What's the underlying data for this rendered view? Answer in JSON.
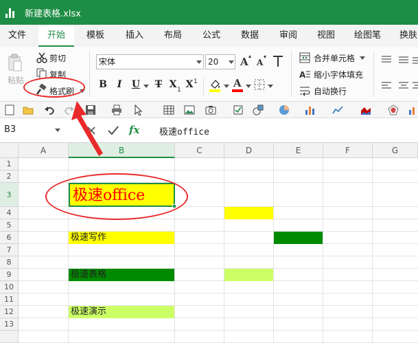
{
  "window": {
    "title": "新建表格.xlsx"
  },
  "menu": {
    "tabs": [
      {
        "label": "文件",
        "active": false
      },
      {
        "label": "开始",
        "active": true
      },
      {
        "label": "模板",
        "active": false
      },
      {
        "label": "插入",
        "active": false
      },
      {
        "label": "布局",
        "active": false
      },
      {
        "label": "公式",
        "active": false
      },
      {
        "label": "数据",
        "active": false
      },
      {
        "label": "审阅",
        "active": false
      },
      {
        "label": "视图",
        "active": false
      },
      {
        "label": "绘图笔",
        "active": false
      },
      {
        "label": "换肤",
        "active": false
      }
    ]
  },
  "ribbon": {
    "paste_label": "粘贴",
    "cut_label": "剪切",
    "copy_label": "复制",
    "format_painter_label": "格式刷",
    "font_name": "宋体",
    "font_size": "20",
    "bold": "B",
    "italic": "I",
    "underline": "U",
    "strikethrough": "T",
    "subscript": "X",
    "subscript_mark": "1",
    "superscript": "X",
    "superscript_mark": "1",
    "font_color_glyph": "A",
    "merge_label": "合并单元格",
    "shrink_label": "缩小字体填充",
    "wrap_label": "自动换行",
    "colors": {
      "highlight": "#ffff00",
      "font_color": "#ff0000"
    }
  },
  "formula_bar": {
    "cell_ref": "B3",
    "fx": "fx",
    "value": "极速office"
  },
  "sheet": {
    "columns": [
      "A",
      "B",
      "C",
      "D",
      "E",
      "F",
      "G"
    ],
    "selected_column": "B",
    "rows": [
      "1",
      "2",
      "3",
      "4",
      "5",
      "6",
      "7",
      "8",
      "9",
      "10",
      "11",
      "12",
      "13"
    ],
    "selected_row": "3",
    "cells": {
      "B3": "极速office",
      "B6": "极速写作",
      "B9": "极速表格",
      "B12": "极速演示"
    },
    "fill_colors": {
      "yellow": "#ffff00",
      "dark_green": "#008a00",
      "light_green": "#ccff66"
    }
  },
  "theme": {
    "accent": "#1e8d45",
    "annotation": "#e82a2a"
  }
}
